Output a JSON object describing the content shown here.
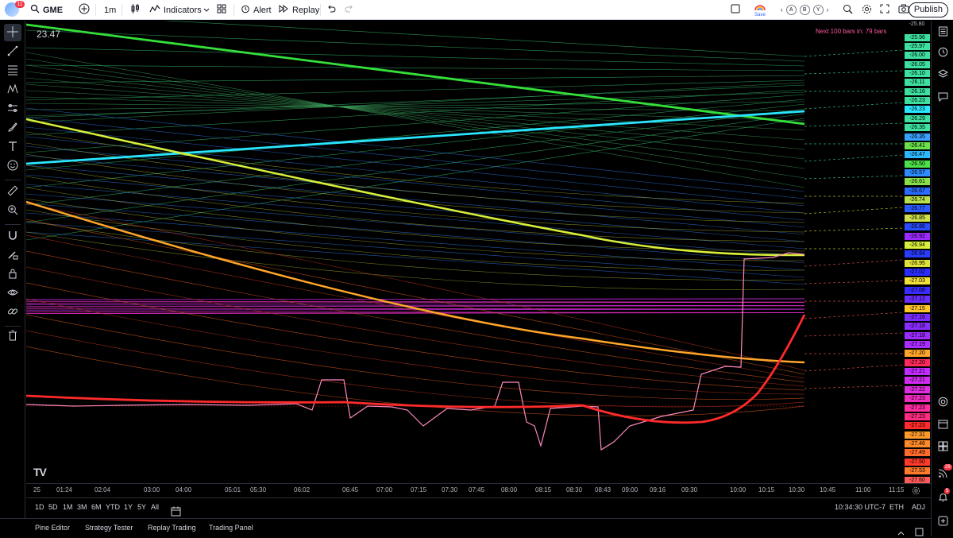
{
  "topbar": {
    "avatar_badge": "11",
    "symbol": "GME",
    "interval": "1m",
    "indicators_label": "Indicators",
    "alert_label": "Alert",
    "replay_label": "Replay",
    "save_label": "Save",
    "layout_letters": [
      "A",
      "B",
      "Y"
    ],
    "publish_label": "Publish"
  },
  "chart": {
    "last_price": "23.47",
    "next_bars_text": "Next 100 bars in: 79 bars",
    "logo_text": "TV",
    "price_scale_top": "-25.80",
    "price_labels": [
      {
        "text": "-25.96",
        "color": "#3ee0a0"
      },
      {
        "text": "-25.97",
        "color": "#3ee0a0"
      },
      {
        "text": "-26.00",
        "color": "#3ee0a0"
      },
      {
        "text": "-26.05",
        "color": "#3ee0a0"
      },
      {
        "text": "-26.10",
        "color": "#3ee0a0"
      },
      {
        "text": "-26.11",
        "color": "#3ee0a0"
      },
      {
        "text": "-26.16",
        "color": "#3ee0a0"
      },
      {
        "text": "-26.23",
        "color": "#3ee0a0"
      },
      {
        "text": "-26.23",
        "color": "#29e6ff"
      },
      {
        "text": "-26.29",
        "color": "#3ee0a0"
      },
      {
        "text": "-26.35",
        "color": "#3ee0a0"
      },
      {
        "text": "-26.35",
        "color": "#3aa0ff"
      },
      {
        "text": "-26.41",
        "color": "#6ae04a"
      },
      {
        "text": "-26.47",
        "color": "#2db7ff"
      },
      {
        "text": "-26.50",
        "color": "#4ee04a"
      },
      {
        "text": "-26.57",
        "color": "#2d8cff"
      },
      {
        "text": "-26.61",
        "color": "#86e04a"
      },
      {
        "text": "-26.67",
        "color": "#2a6cff"
      },
      {
        "text": "-26.74",
        "color": "#b8e04a"
      },
      {
        "text": "-26.77",
        "color": "#2a5cff"
      },
      {
        "text": "-26.85",
        "color": "#cfe04a"
      },
      {
        "text": "-26.86",
        "color": "#2a4cff"
      },
      {
        "text": "-26.92",
        "color": "#9b2aff"
      },
      {
        "text": "-26.94",
        "color": "#d8f03a"
      },
      {
        "text": "-26.94",
        "color": "#2a3cff"
      },
      {
        "text": "-26.95",
        "color": "#e0e03a"
      },
      {
        "text": "-27.02",
        "color": "#2a2cff"
      },
      {
        "text": "-27.03",
        "color": "#f2e03a"
      },
      {
        "text": "-27.08",
        "color": "#3a2cff"
      },
      {
        "text": "-27.12",
        "color": "#6a2cff"
      },
      {
        "text": "-27.15",
        "color": "#ffc62a"
      },
      {
        "text": "-27.16",
        "color": "#7a2cff"
      },
      {
        "text": "-27.18",
        "color": "#8a2cff"
      },
      {
        "text": "-27.18",
        "color": "#9a2cff"
      },
      {
        "text": "-27.19",
        "color": "#aa2cff"
      },
      {
        "text": "-27.20",
        "color": "#ffa62a"
      },
      {
        "text": "-27.20",
        "color": "#ff2a5a"
      },
      {
        "text": "-27.21",
        "color": "#c02cff"
      },
      {
        "text": "-27.21",
        "color": "#d02cf0"
      },
      {
        "text": "-27.22",
        "color": "#e02ce0"
      },
      {
        "text": "-27.23",
        "color": "#f02cc0"
      },
      {
        "text": "-27.23",
        "color": "#ff2ca0"
      },
      {
        "text": "-27.23",
        "color": "#ff2c80"
      },
      {
        "text": "-27.23",
        "color": "#ff2a2a"
      },
      {
        "text": "-27.31",
        "color": "#ff9a2a"
      },
      {
        "text": "-27.46",
        "color": "#ff8a2a"
      },
      {
        "text": "-27.49",
        "color": "#ff6a2a"
      },
      {
        "text": "-27.50",
        "color": "#ff3a2a"
      },
      {
        "text": "-27.53",
        "color": "#ff7a2a"
      },
      {
        "text": "-27.60",
        "color": "#ff5a5a"
      }
    ]
  },
  "time_axis": [
    "25",
    "01:24",
    "02:04",
    "03:00",
    "04:00",
    "05:01",
    "05:30",
    "06:02",
    "06:45",
    "07:00",
    "07:15",
    "07:30",
    "07:45",
    "08:00",
    "08:15",
    "08:30",
    "08:43",
    "09:00",
    "09:16",
    "09:30",
    "10:00",
    "10:15",
    "10:30",
    "10:45",
    "11:00",
    "11:15"
  ],
  "bottom_controls": {
    "ranges": [
      "1D",
      "5D",
      "1M",
      "3M",
      "6M",
      "YTD",
      "1Y",
      "5Y",
      "All"
    ],
    "clock": "10:34:30 UTC-7",
    "session": "ETH",
    "adj": "ADJ"
  },
  "bottom_panel": {
    "tabs": [
      "Pine Editor",
      "Strategy Tester",
      "Replay Trading",
      "Trading Panel"
    ]
  },
  "right_toolbar": {
    "ideas_badge": "29",
    "notif_badge": "5"
  },
  "colors": {
    "background": "#000000",
    "accent_red": "#ff2a2a",
    "accent_cyan": "#29e6ff",
    "accent_green": "#35e03a",
    "accent_yellow": "#d8f03a",
    "accent_orange": "#ffa62a",
    "accent_magenta": "#e02ce0"
  }
}
